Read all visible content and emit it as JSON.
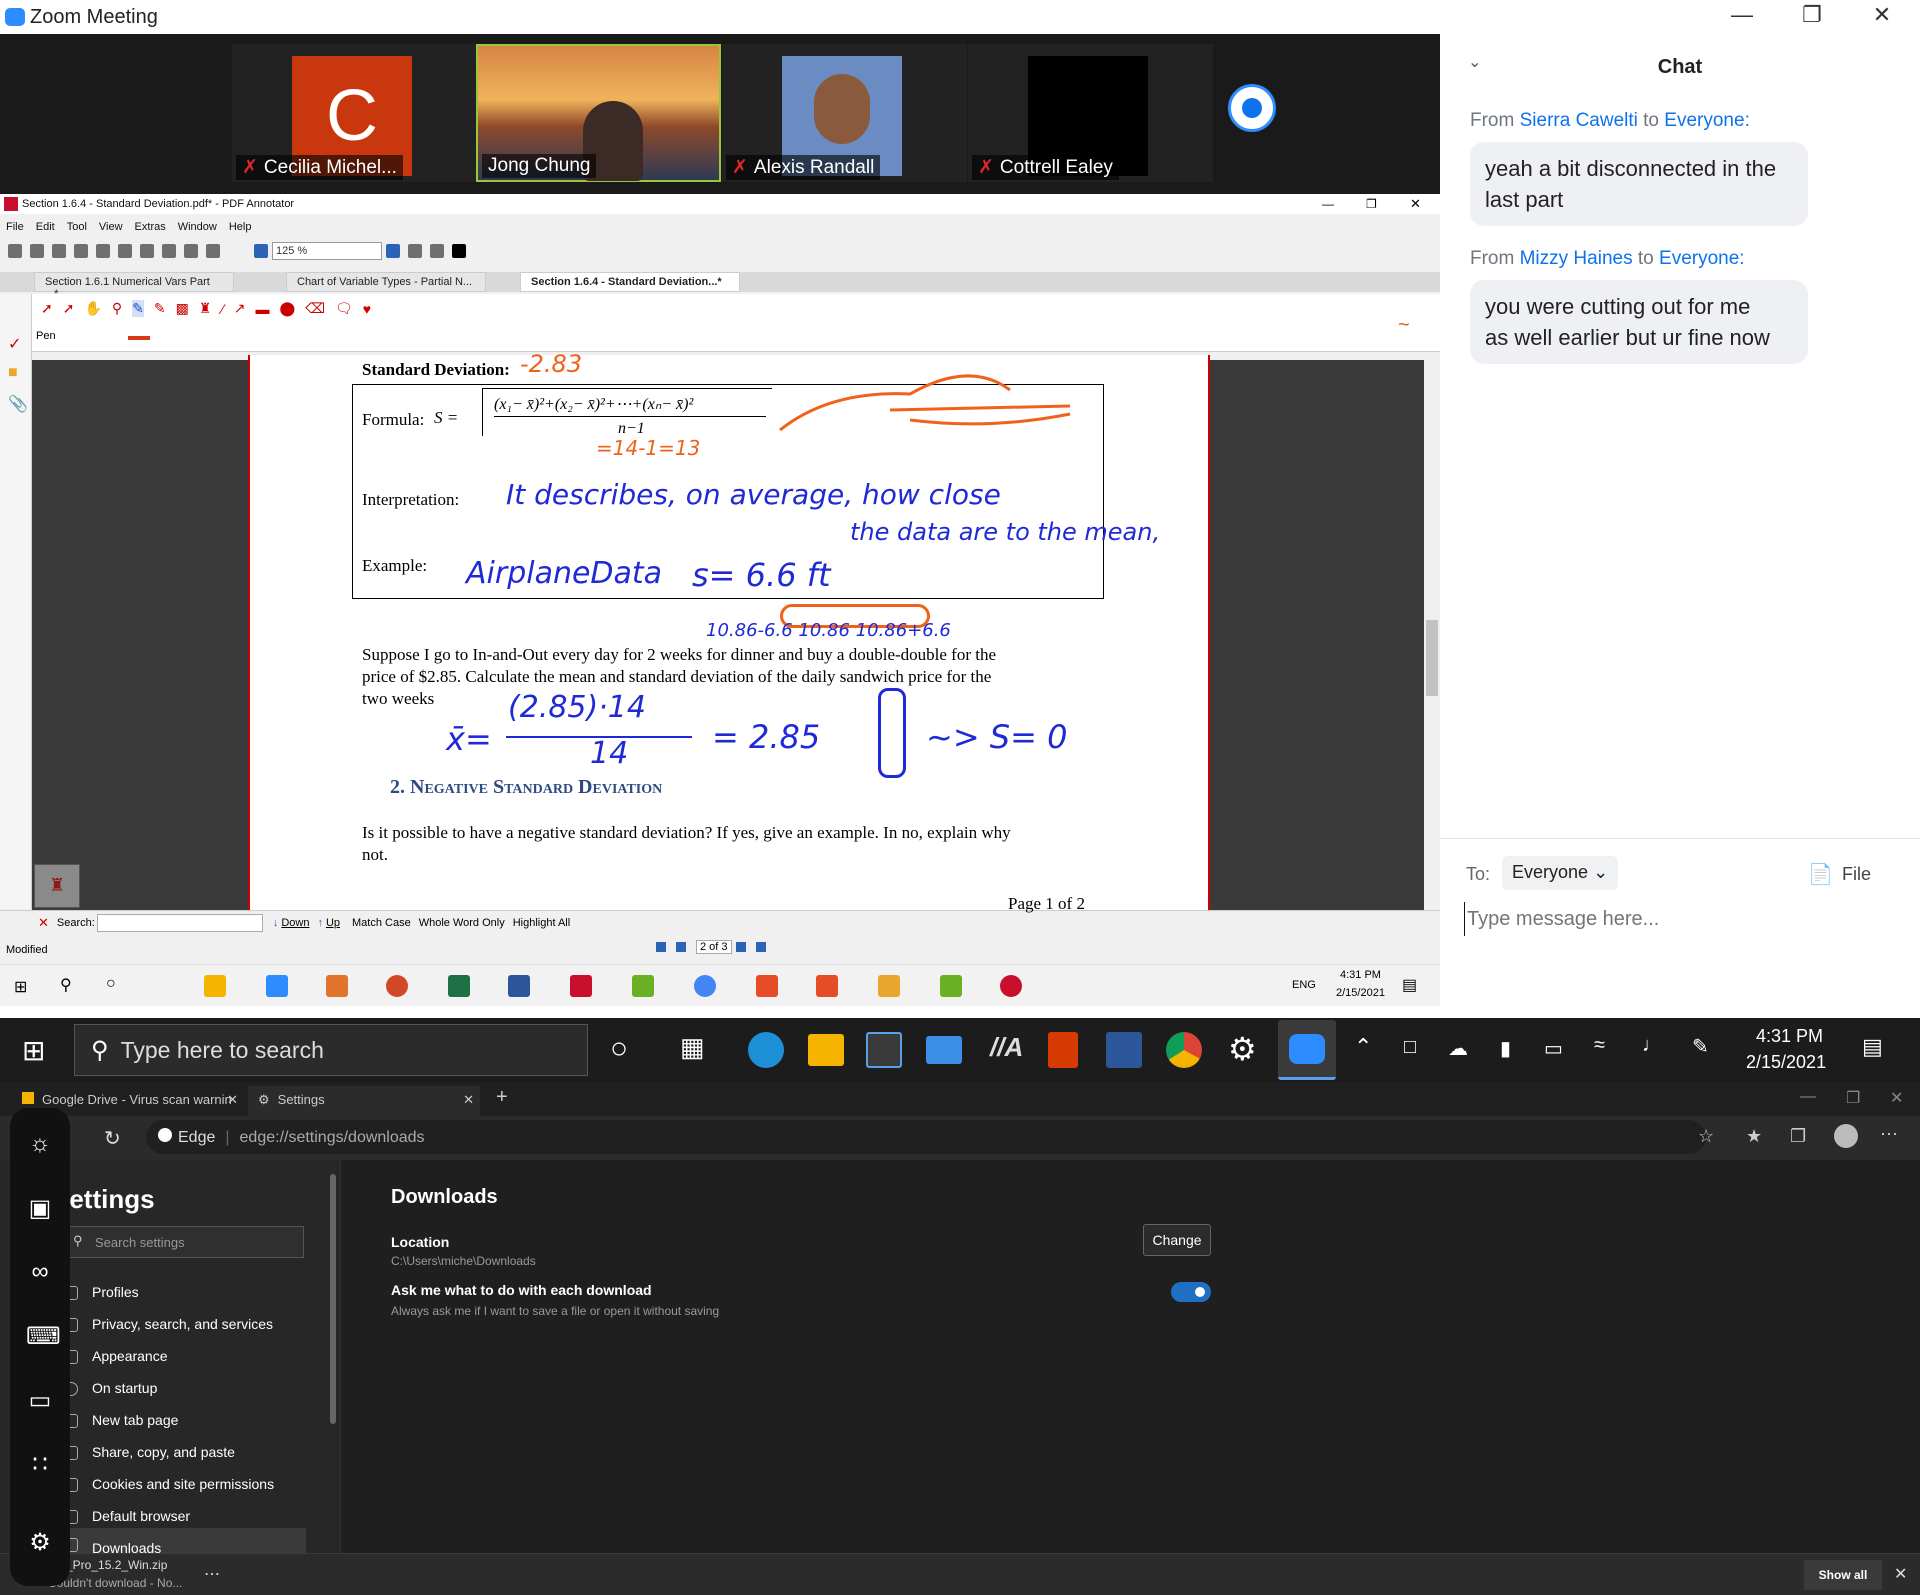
{
  "zoom": {
    "window_title": "Zoom Meeting",
    "participants": [
      {
        "name": "Cecilia Michel...",
        "initial": "C",
        "muted": true
      },
      {
        "name": "Jong Chung",
        "muted": false
      },
      {
        "name": "Alexis Randall",
        "muted": true
      },
      {
        "name": "Cottrell Ealey",
        "muted": true
      }
    ],
    "chat": {
      "title": "Chat",
      "messages": [
        {
          "from_label": "From",
          "sender": "Sierra Cawelti",
          "to_label": "to",
          "recipient": "Everyone:",
          "text_line1": "yeah a bit disconnected in the",
          "text_line2": "last part"
        },
        {
          "from_label": "From",
          "sender": "Mizzy Haines",
          "to_label": "to",
          "recipient": "Everyone:",
          "text_line1": "you were cutting out for me",
          "text_line2": "as well earlier but ur fine now"
        }
      ],
      "to_label": "To:",
      "to_value": "Everyone",
      "file_label": "File",
      "input_placeholder": "Type message here..."
    }
  },
  "pdf": {
    "title": "Section 1.6.4 - Standard Deviation.pdf* - PDF Annotator",
    "menu": [
      "File",
      "Edit",
      "Tool",
      "View",
      "Extras",
      "Window",
      "Help"
    ],
    "zoom_value": "125 %",
    "tabs": [
      "Section 1.6.1 Numerical Vars Part ...*",
      "Chart of Variable Types - Partial N...",
      "Section 1.6.4 - Standard Deviation...*"
    ],
    "tool_label": "Pen",
    "doc": {
      "heading": "Standard Deviation:",
      "formula_label": "Formula:",
      "formula_s": "S =",
      "formula_num": "(x₁− x̄)²+(x₂− x̄)²+⋯+(xₙ− x̄)²",
      "formula_den": "n−1",
      "interpretation_label": "Interpretation:",
      "example_label": "Example:",
      "hw_interp1": "It describes, on average, how close",
      "hw_interp2": "the data are to the mean,",
      "hw_example_name": "AirplaneData",
      "hw_example_value": "s= 6.6 ft",
      "hw_range": "10.86-6.6   10.86   10.86+6.6",
      "problem_line1": "Suppose I go to In-and-Out every day for 2 weeks for dinner and buy a double-double for the",
      "problem_line2": "price of $2.85.  Calculate the mean and standard deviation of the daily sandwich price for the",
      "problem_line3": "two weeks",
      "hw_mean_lhs": "x̄=",
      "hw_mean_num": "(2.85)·14",
      "hw_mean_den": "14",
      "hw_mean_rhs": "= 2.85",
      "hw_sd": "~> S= 0",
      "section_num": "2.",
      "section_title": "Negative Standard Deviation",
      "q_line1": "Is it possible to have a negative standard deviation? If yes, give an example. In no, explain why",
      "q_line2": "not.",
      "page_footer": "Page 1 of 2"
    },
    "search_label": "Search:",
    "search_down": "Down",
    "search_up": "Up",
    "search_opts": [
      "Match Case",
      "Whole Word Only",
      "Highlight All"
    ],
    "status": "Modified",
    "page_indicator": "2 of 3"
  },
  "remote_taskbar": {
    "time": "4:31 PM",
    "date": "2/15/2021",
    "lang": "ENG"
  },
  "win_taskbar": {
    "search_placeholder": "Type here to search",
    "time": "4:31 PM",
    "date": "2/15/2021"
  },
  "edge": {
    "tabs": [
      {
        "label": "Google Drive - Virus scan warnin"
      },
      {
        "label": "Settings"
      }
    ],
    "address_prefix": "Edge",
    "address": "edge://settings/downloads",
    "settings_title": "Settings",
    "search_placeholder": "Search settings",
    "sidebar": [
      "Profiles",
      "Privacy, search, and services",
      "Appearance",
      "On startup",
      "New tab page",
      "Share, copy, and paste",
      "Cookies and site permissions",
      "Default browser",
      "Downloads"
    ],
    "page_title": "Downloads",
    "location_label": "Location",
    "location_path": "C:\\Users\\miche\\Downloads",
    "change_button": "Change",
    "ask_label": "Ask me what to do with each download",
    "ask_desc": "Always ask me if I want to save a file or open it without saving",
    "ask_enabled": true,
    "download_file": "MP_Pro_15.2_Win.zip",
    "download_status": "Couldn't download - No...",
    "show_all": "Show all"
  }
}
